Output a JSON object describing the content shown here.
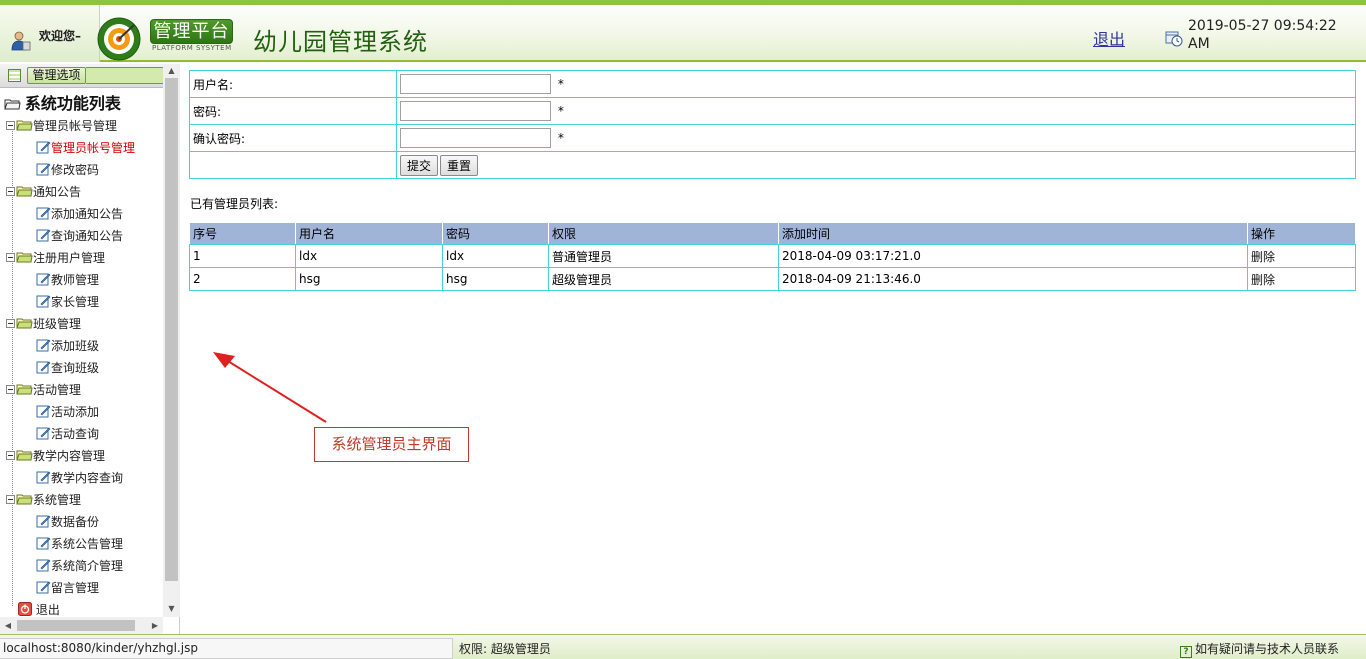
{
  "header": {
    "welcome": "欢迎您–",
    "logo_text": "管理平台",
    "logo_subtext": "PLATFORM SYSYTEM",
    "system_title": "幼儿园管理系统",
    "logout": "退出",
    "datetime": "2019-05-27 09:54:22 AM"
  },
  "sidebar": {
    "panel_button": "管理选项",
    "root": "系统功能列表",
    "groups": [
      {
        "label": "管理员帐号管理",
        "items": [
          "管理员帐号管理",
          "修改密码"
        ]
      },
      {
        "label": "通知公告",
        "items": [
          "添加通知公告",
          "查询通知公告"
        ]
      },
      {
        "label": "注册用户管理",
        "items": [
          "教师管理",
          "家长管理"
        ]
      },
      {
        "label": "班级管理",
        "items": [
          "添加班级",
          "查询班级"
        ]
      },
      {
        "label": "活动管理",
        "items": [
          "活动添加",
          "活动查询"
        ]
      },
      {
        "label": "教学内容管理",
        "items": [
          "教学内容查询"
        ]
      },
      {
        "label": "系统管理",
        "items": [
          "数据备份",
          "系统公告管理",
          "系统简介管理",
          "留言管理"
        ]
      }
    ],
    "exit": "退出"
  },
  "form": {
    "username_label": "用户名:",
    "password_label": "密码:",
    "confirm_label": "确认密码:",
    "required_mark": "*",
    "submit": "提交",
    "reset": "重置"
  },
  "list": {
    "caption": "已有管理员列表:",
    "headers": [
      "序号",
      "用户名",
      "密码",
      "权限",
      "添加时间",
      "操作"
    ],
    "rows": [
      [
        "1",
        "ldx",
        "ldx",
        "普通管理员",
        "2018-04-09 03:17:21.0",
        "删除"
      ],
      [
        "2",
        "hsg",
        "hsg",
        "超级管理员",
        "2018-04-09 21:13:46.0",
        "删除"
      ]
    ]
  },
  "annotation": "系统管理员主界面",
  "status": {
    "url": "localhost:8080/kinder/yhzhgl.jsp",
    "permission": "权限:  超级管理员",
    "help": "如有疑问请与技术人员联系"
  },
  "colors": {
    "brand_green": "#8cc63f",
    "table_border": "#45d2d8",
    "table_header": "#a0b4d8",
    "active_link": "#d40000",
    "annotation_red": "#c0392b"
  }
}
